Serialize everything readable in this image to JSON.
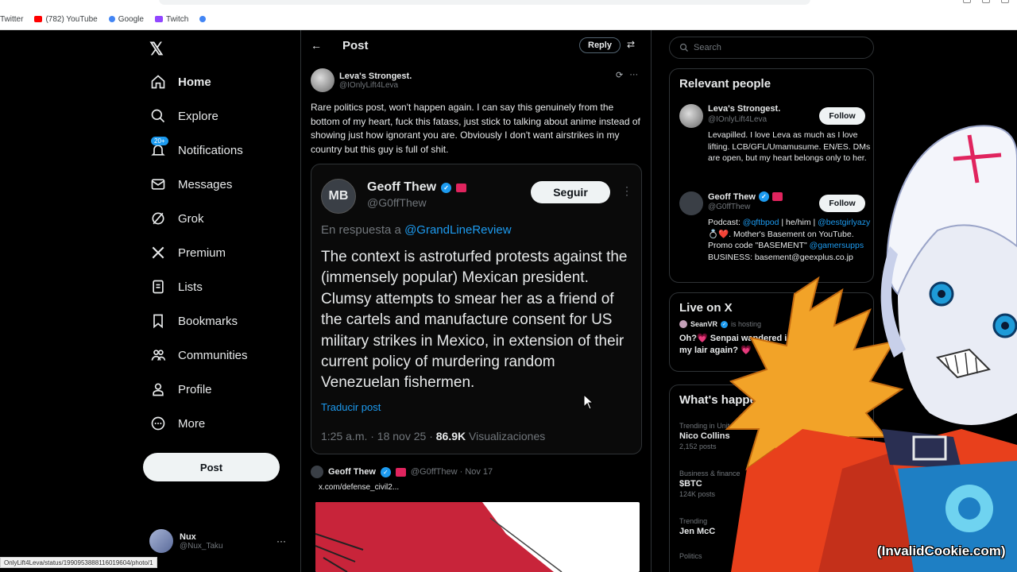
{
  "browser": {
    "bookmarks": [
      {
        "label": "Twitter",
        "color": "#888888"
      },
      {
        "label": "(782) YouTube",
        "color": "#ff0000"
      },
      {
        "label": "Google",
        "color": "#4285f4"
      },
      {
        "label": "Twitch",
        "color": "#9146ff"
      },
      {
        "label": "",
        "color": "#4285f4"
      }
    ],
    "status_url": "OnlyLift4Leva/status/1990953888116019604/photo/1"
  },
  "nav": {
    "logo": "𝕏",
    "items": [
      {
        "label": "Home",
        "icon": "home-icon"
      },
      {
        "label": "Explore",
        "icon": "search-icon"
      },
      {
        "label": "Notifications",
        "icon": "bell-icon",
        "badge": "20+"
      },
      {
        "label": "Messages",
        "icon": "mail-icon"
      },
      {
        "label": "Grok",
        "icon": "grok-icon"
      },
      {
        "label": "Premium",
        "icon": "x-icon"
      },
      {
        "label": "Lists",
        "icon": "list-icon"
      },
      {
        "label": "Bookmarks",
        "icon": "bookmark-icon"
      },
      {
        "label": "Communities",
        "icon": "people-icon"
      },
      {
        "label": "Profile",
        "icon": "person-icon"
      },
      {
        "label": "More",
        "icon": "more-circle-icon"
      }
    ],
    "post_label": "Post",
    "me": {
      "name": "Nux",
      "handle": "@Nux_Taku",
      "more": "···"
    }
  },
  "main": {
    "back": "←",
    "title": "Post",
    "reply_label": "Reply",
    "tune": "⇄",
    "author": {
      "name": "Leva's Strongest.",
      "handle": "@IOnlyLift4Leva"
    },
    "author_icons": [
      "⟳",
      "···"
    ],
    "text": "Rare politics post, won't happen again. I can say this genuinely from the bottom of my heart, fuck this fatass, just stick to talking about anime instead of showing just how ignorant you are. Obviously I don't want airstrikes in my country but this guy is full of shit.",
    "quote": {
      "avatar": "MB",
      "name": "Geoff Thew",
      "handle": "@G0ffThew",
      "follow_label": "Seguir",
      "more": "⋮",
      "reply_prefix": "En respuesta a",
      "reply_mention": "@GrandLineReview",
      "text": "The context is astroturfed protests against the (immensely popular) Mexican president. Clumsy attempts to smear her as a friend of the cartels and manufacture consent for US military strikes in Mexico, in extension of their current policy of murdering random Venezuelan fishermen.",
      "translate": "Traducir post",
      "time": "1:25 a.m. · 18 nov 25 · ",
      "views": "86.9K",
      "views_label": "Visualizaciones"
    },
    "reply2": {
      "name": "Geoff Thew",
      "handle": "@G0ffThew · Nov 17",
      "link": "x.com/defense_civil2..."
    }
  },
  "right": {
    "search_placeholder": "Search",
    "relevant_title": "Relevant people",
    "people": [
      {
        "name": "Leva's Strongest.",
        "handle": "@IOnlyLift4Leva",
        "follow": "Follow",
        "bio": "Levapilled. I love Leva as much as I love lifting. LCB/GFL/Umamusume. EN/ES. DMs are open, but my heart belongs only to her."
      },
      {
        "name": "Geoff Thew",
        "handle": "@G0ffThew",
        "follow": "Follow",
        "bio_pre": "Podcast: ",
        "bio_l1": "@qftbpod",
        "bio_mid": " | he/him | ",
        "bio_l2": "@bestgirlyazy",
        "bio_mid2": " 💍❤️. Mother's Basement on YouTube. Promo code \"BASEMENT\" ",
        "bio_l3": "@gamersupps",
        "bio_end": " BUSINESS: basement@geexplus.co.jp"
      }
    ],
    "live": {
      "title": "Live on X",
      "host": "SeanVR",
      "hosting": "is hosting",
      "space_title": "Oh?💗 Senpai wandered in my lair again? 💗"
    },
    "happening": {
      "title": "What's happening",
      "trends": [
        {
          "context": "Trending in United States",
          "name": "Nico Collins",
          "count": "2,152 posts"
        },
        {
          "context": "Business & finance",
          "name": "$BTC",
          "count": "124K posts"
        },
        {
          "context": "Trending",
          "name": "Jen McC",
          "count": ""
        },
        {
          "context": "Politics",
          "name": "",
          "count": ""
        }
      ]
    }
  },
  "overlay": {
    "watermark": "(InvalidCookie.com)"
  }
}
